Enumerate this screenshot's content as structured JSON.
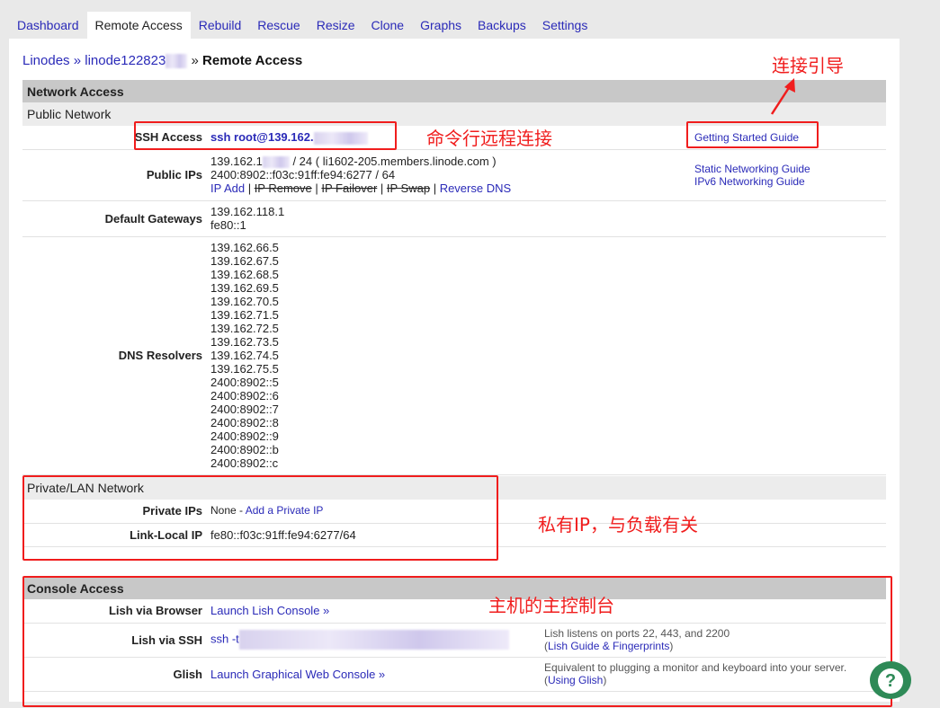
{
  "tabs": [
    "Dashboard",
    "Remote Access",
    "Rebuild",
    "Rescue",
    "Resize",
    "Clone",
    "Graphs",
    "Backups",
    "Settings"
  ],
  "breadcrumb": {
    "root": "Linodes",
    "linode": "linode122823",
    "current": "Remote Access",
    "sep": "»"
  },
  "network": {
    "title": "Network Access",
    "public_title": "Public Network",
    "ssh_label": "SSH Access",
    "ssh_value": "ssh root@139.162.",
    "getting_started": "Getting Started Guide",
    "public_ips_label": "Public IPs",
    "ipv4": "139.162.1",
    "ipv4_suffix": " / 24 ( li1602-205.members.linode.com )",
    "ipv6": "2400:8902::f03c:91ff:fe94:6277 / 64",
    "actions": [
      "IP Add",
      "IP Remove",
      "IP Failover",
      "IP Swap",
      "Reverse DNS"
    ],
    "static_guide": "Static Networking Guide",
    "ipv6_guide": "IPv6 Networking Guide",
    "gateways_label": "Default Gateways",
    "gateways": [
      "139.162.118.1",
      "fe80::1"
    ],
    "dns_label": "DNS Resolvers",
    "dns": [
      "139.162.66.5",
      "139.162.67.5",
      "139.162.68.5",
      "139.162.69.5",
      "139.162.70.5",
      "139.162.71.5",
      "139.162.72.5",
      "139.162.73.5",
      "139.162.74.5",
      "139.162.75.5",
      "2400:8902::5",
      "2400:8902::6",
      "2400:8902::7",
      "2400:8902::8",
      "2400:8902::9",
      "2400:8902::b",
      "2400:8902::c"
    ],
    "private_title": "Private/LAN Network",
    "private_label": "Private IPs",
    "private_none": "None - ",
    "private_add": "Add a Private IP",
    "linklocal_label": "Link-Local IP",
    "linklocal": "fe80::f03c:91ff:fe94:6277/64"
  },
  "console": {
    "title": "Console Access",
    "browser_label": "Lish via Browser",
    "browser_link": "Launch Lish Console »",
    "ssh_label": "Lish via SSH",
    "ssh_value": "ssh -t",
    "ssh_note": "Lish listens on ports 22, 443, and 2200",
    "ssh_guide": "Lish Guide & Fingerprints",
    "glish_label": "Glish",
    "glish_link": "Launch Graphical Web Console »",
    "glish_note": "Equivalent to plugging a monitor and keyboard into your server.",
    "glish_guide": "Using Glish"
  },
  "annotations": {
    "ssh": "命令行远程连接",
    "guide": "连接引导",
    "private": "私有IP，与负载有关",
    "console": "主机的主控制台"
  },
  "colors": {
    "annotation": "#f01d1d",
    "link": "#2a2ab8",
    "help": "#2e8a57"
  },
  "help_icon": "?"
}
